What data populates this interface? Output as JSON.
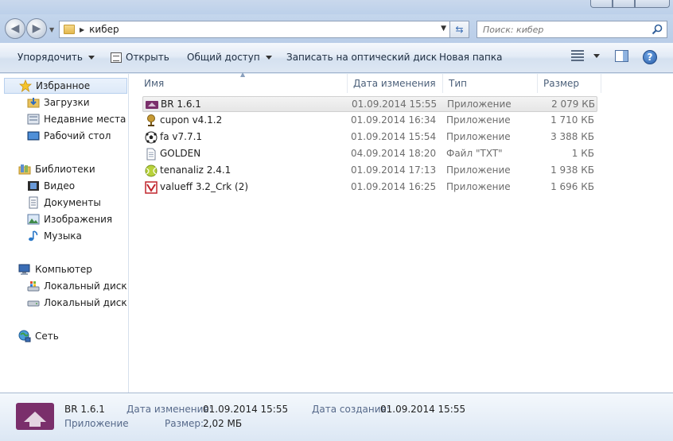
{
  "address": {
    "crumb": "кибер",
    "search_placeholder": "Поиск: кибер"
  },
  "toolbar": {
    "organize": "Упорядочить",
    "open": "Открыть",
    "share": "Общий доступ",
    "burn": "Записать на оптический диск",
    "new_folder": "Новая папка"
  },
  "nav": {
    "favorites": "Избранное",
    "downloads": "Загрузки",
    "recent": "Недавние места",
    "desktop": "Рабочий стол",
    "libraries": "Библиотеки",
    "video": "Видео",
    "documents": "Документы",
    "images": "Изображения",
    "music": "Музыка",
    "computer": "Компьютер",
    "disk_c": "Локальный диск (C",
    "disk_e": "Локальный диск (E:",
    "network": "Сеть"
  },
  "columns": {
    "name": "Имя",
    "date": "Дата изменения",
    "type": "Тип",
    "size": "Размер"
  },
  "files": [
    {
      "name": "BR 1.6.1",
      "date": "01.09.2014 15:55",
      "type": "Приложение",
      "size": "2 079 КБ",
      "icon": "br-app-icon"
    },
    {
      "name": "cupon v4.1.2",
      "date": "01.09.2014 16:34",
      "type": "Приложение",
      "size": "1 710 КБ",
      "icon": "trophy-icon"
    },
    {
      "name": "fa v7.7.1",
      "date": "01.09.2014 15:54",
      "type": "Приложение",
      "size": "3 388 КБ",
      "icon": "soccer-ball-icon"
    },
    {
      "name": "GOLDEN",
      "date": "04.09.2014 18:20",
      "type": "Файл \"TXT\"",
      "size": "1 КБ",
      "icon": "text-file-icon"
    },
    {
      "name": "tenanaliz 2.4.1",
      "date": "01.09.2014 17:13",
      "type": "Приложение",
      "size": "1 938 КБ",
      "icon": "tennis-ball-icon"
    },
    {
      "name": "valueff 3.2_Crk (2)",
      "date": "01.09.2014 16:25",
      "type": "Приложение",
      "size": "1 696 КБ",
      "icon": "valueff-app-icon"
    }
  ],
  "details": {
    "name": "BR 1.6.1",
    "type": "Приложение",
    "modified_label": "Дата изменения:",
    "modified_value": "01.09.2014 15:55",
    "created_label": "Дата создания:",
    "created_value": "01.09.2014 15:55",
    "size_label": "Размер:",
    "size_value": "2,02 МБ"
  },
  "colors": {
    "accent": "#3a6db5",
    "br_icon": "#7a2f6b"
  }
}
